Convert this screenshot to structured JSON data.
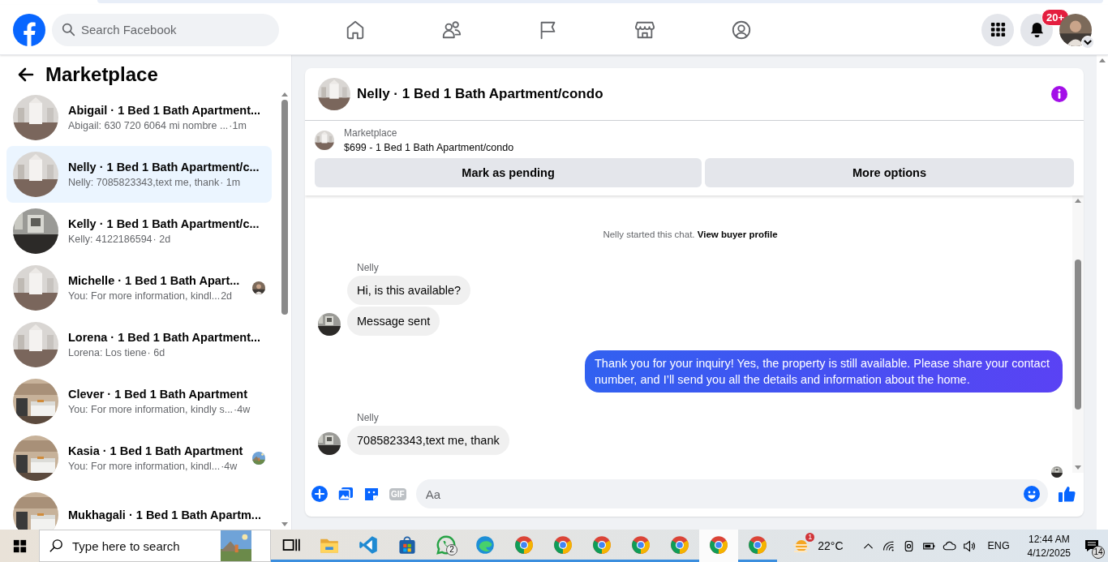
{
  "header": {
    "search": {
      "placeholder": "Search Facebook"
    },
    "notification_count": "20+"
  },
  "sidebar": {
    "title": "Marketplace",
    "conversations": [
      {
        "title": "Abigail · 1 Bed 1 Bath Apartment...",
        "preview": "Abigail: 630 720 6064 mi nombre ...",
        "time": " ·1m",
        "selected": false,
        "seen": false
      },
      {
        "title": "Nelly · 1 Bed 1 Bath Apartment/c...",
        "preview": "Nelly: 7085823343,text me, thank",
        "time": "· 1m",
        "selected": true,
        "seen": false
      },
      {
        "title": "Kelly · 1 Bed 1 Bath Apartment/c...",
        "preview": "Kelly: 4122186594",
        "time": "· 2d",
        "selected": false,
        "seen": false
      },
      {
        "title": "Michelle · 1 Bed 1 Bath Apart...",
        "preview": "You: For more information, kindl...",
        "time": " 2d",
        "selected": false,
        "seen": true
      },
      {
        "title": "Lorena · 1 Bed 1 Bath Apartment...",
        "preview": "Lorena: Los tiene",
        "time": "· 6d",
        "selected": false,
        "seen": false
      },
      {
        "title": "Clever · 1 Bed 1 Bath Apartment",
        "preview": "You: For more information, kindly s...",
        "time": " ·4w",
        "selected": false,
        "seen": false
      },
      {
        "title": "Kasia · 1 Bed 1 Bath Apartment",
        "preview": "You: For more information, kindl...",
        "time": " ·4w",
        "selected": false,
        "seen": true
      },
      {
        "title": "Mukhagali · 1 Bed 1 Bath Apartm...",
        "selected": false,
        "seen": false
      }
    ]
  },
  "chat": {
    "title": "Nelly · 1 Bed 1 Bath Apartment/condo",
    "listing": {
      "source": "Marketplace",
      "description": "$699 - 1 Bed 1 Bath Apartment/condo"
    },
    "buttons": [
      "Mark as pending",
      "More options"
    ],
    "notice": {
      "text": "Nelly started this chat.",
      "link": "View buyer profile"
    },
    "groups": [
      {
        "kind": "incoming",
        "sender": "Nelly",
        "messages": [
          "Hi, is this available?",
          "Message sent"
        ]
      },
      {
        "kind": "outgoing",
        "messages": [
          "Thank you for your inquiry! Yes, the property is still available. Please share your contact number, and I’ll send you all the details and information about the home."
        ]
      },
      {
        "kind": "incoming",
        "sender": "Nelly",
        "messages": [
          "7085823343,text me, thank"
        ]
      }
    ],
    "composer": {
      "placeholder": "Aa",
      "gif_label": "GIF"
    }
  },
  "taskbar": {
    "search_placeholder": "Type here to search",
    "apps": [
      {
        "kind": "task-view",
        "active": false
      },
      {
        "kind": "folder",
        "active": false
      },
      {
        "kind": "code",
        "active": false
      },
      {
        "kind": "store",
        "active": false
      },
      {
        "kind": "chat",
        "active": false,
        "badge": "2"
      },
      {
        "kind": "edge",
        "active": false
      },
      {
        "kind": "chrome",
        "active": false
      },
      {
        "kind": "chrome",
        "active": false
      },
      {
        "kind": "chrome",
        "active": false
      },
      {
        "kind": "chrome",
        "active": false
      },
      {
        "kind": "chrome",
        "active": false
      },
      {
        "kind": "chrome",
        "active": true
      },
      {
        "kind": "chrome",
        "active": false
      }
    ],
    "weather": {
      "temperature": "22°C",
      "badge": "1"
    },
    "language": "ENG",
    "time": "12:44 AM",
    "date": "4/12/2025",
    "notification_count": "14"
  }
}
